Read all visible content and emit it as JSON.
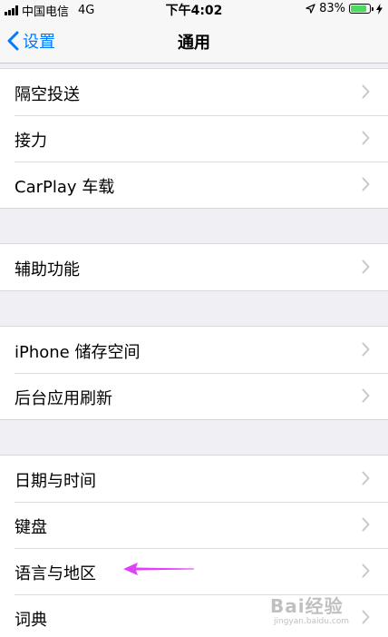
{
  "status_bar": {
    "carrier": "中国电信",
    "network": "4G",
    "time": "下午4:02",
    "battery_percent": "83%",
    "battery_level": 0.83,
    "battery_color": "#4cd964"
  },
  "nav": {
    "back_label": "设置",
    "title": "通用",
    "accent_color": "#007aff"
  },
  "groups": [
    {
      "items": [
        {
          "label": "隔空投送"
        },
        {
          "label": "接力"
        },
        {
          "label": "CarPlay 车载"
        }
      ]
    },
    {
      "items": [
        {
          "label": "辅助功能"
        }
      ]
    },
    {
      "items": [
        {
          "label": "iPhone 储存空间"
        },
        {
          "label": "后台应用刷新"
        }
      ]
    },
    {
      "items": [
        {
          "label": "日期与时间"
        },
        {
          "label": "键盘"
        },
        {
          "label": "语言与地区"
        },
        {
          "label": "词典"
        }
      ]
    }
  ],
  "annotation": {
    "arrow_color": "#e040fb",
    "points_to": "语言与地区"
  },
  "watermark": {
    "brand": "Bai经验",
    "url": "jingyan.baidu.com"
  }
}
